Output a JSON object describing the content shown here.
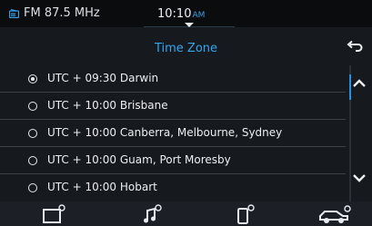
{
  "status_bar": {
    "source_label": "FM 87.5 MHz",
    "source_icon": "radio-icon",
    "time": "10:10",
    "ampm": "AM"
  },
  "header": {
    "title": "Time Zone",
    "back_icon": "back-arrow-icon"
  },
  "timezone_list": {
    "items": [
      {
        "label": "UTC + 09:30 Darwin",
        "selected": true
      },
      {
        "label": "UTC + 10:00 Brisbane",
        "selected": false
      },
      {
        "label": "UTC + 10:00 Canberra, Melbourne, Sydney",
        "selected": false
      },
      {
        "label": "UTC + 10:00 Guam, Port Moresby",
        "selected": false
      },
      {
        "label": "UTC + 10:00 Hobart",
        "selected": false
      }
    ]
  },
  "scrollbar": {
    "up_icon": "chevron-up-icon",
    "down_icon": "chevron-down-icon"
  },
  "bottom_bar": {
    "tabs": [
      {
        "icon": "screen-settings-icon"
      },
      {
        "icon": "sound-settings-icon"
      },
      {
        "icon": "phone-settings-icon"
      },
      {
        "icon": "vehicle-settings-icon"
      }
    ]
  },
  "colors": {
    "accent": "#34a6f0",
    "background": "#16191d",
    "text": "#eceff2"
  }
}
